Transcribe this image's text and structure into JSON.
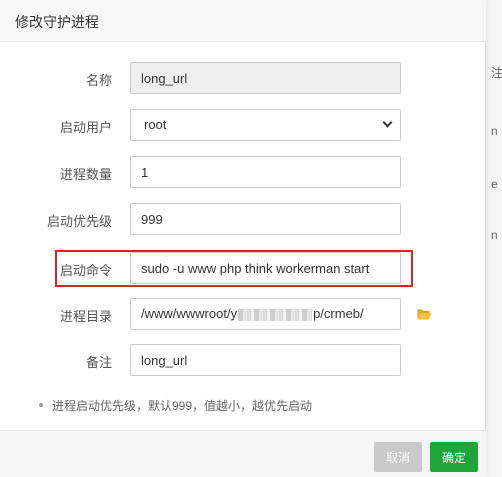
{
  "dialog": {
    "title": "修改守护进程",
    "tip": "进程启动优先级，默认999，值越小，越优先启动"
  },
  "form": {
    "name": {
      "label": "名称",
      "value": "long_url"
    },
    "user": {
      "label": "启动用户",
      "selected": "root"
    },
    "processes": {
      "label": "进程数量",
      "value": "1"
    },
    "priority": {
      "label": "启动优先级",
      "value": "999"
    },
    "command": {
      "label": "启动命令",
      "value": "sudo -u www php think workerman start"
    },
    "directory": {
      "label": "进程目录",
      "value_prefix": "/www/wwwroot/y",
      "value_suffix": "p/crmeb/",
      "folder_icon": "folder-open-icon"
    },
    "remark": {
      "label": "备注",
      "value": "long_url"
    }
  },
  "buttons": {
    "cancel": "取消",
    "confirm": "确定"
  },
  "background": {
    "fragments": [
      "注",
      "n",
      "e",
      "n"
    ]
  },
  "colors": {
    "confirm": "#20a53a",
    "cancel": "#c9c9c9",
    "highlight": "#d9232d",
    "folder": "#e6b82e"
  }
}
